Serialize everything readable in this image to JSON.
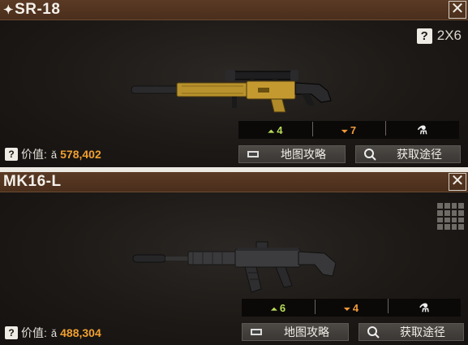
{
  "weapons": [
    {
      "name": "SR-18",
      "title_icon": "sparkle-icon",
      "scope": "2X6",
      "stat_up": "4",
      "stat_down": "7",
      "price_label": "价值:",
      "price_value": "578,402",
      "map_btn": "地图攻略",
      "source_btn": "获取途径"
    },
    {
      "name": "MK16-L",
      "stat_up": "6",
      "stat_down": "4",
      "price_label": "价值:",
      "price_value": "488,304",
      "map_btn": "地图攻略",
      "source_btn": "获取途径"
    }
  ],
  "colors": {
    "accent_up": "#b8dc5a",
    "accent_down": "#f29a3a",
    "price": "#f0a030",
    "titlebar": "#4a2e1c"
  }
}
